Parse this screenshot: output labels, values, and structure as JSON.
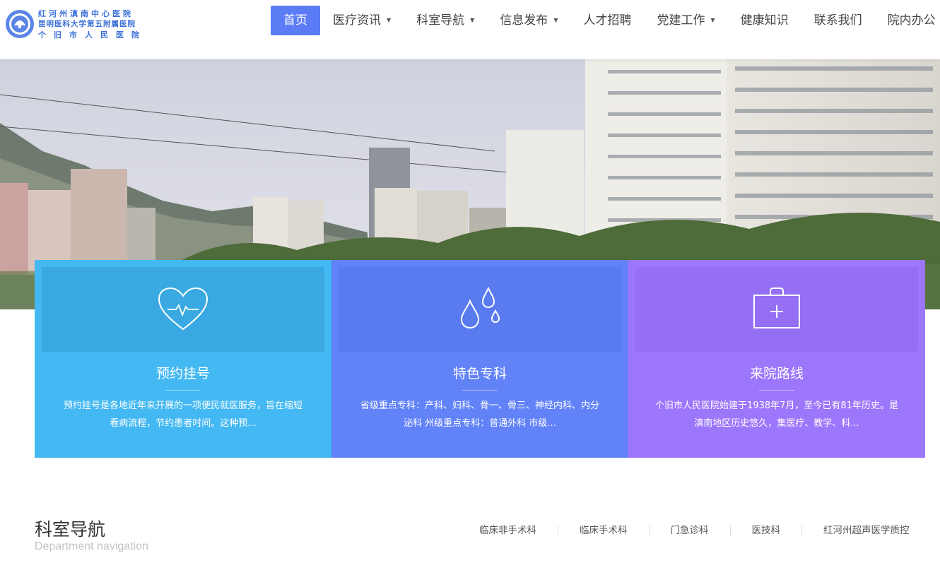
{
  "logo": {
    "line1": "红河州滇南中心医院",
    "line2": "昆明医科大学第五附属医院",
    "line3": "个旧市人民医院",
    "emblem_icon": "hospital-emblem-icon"
  },
  "nav": {
    "items": [
      {
        "label": "首页",
        "active": true
      },
      {
        "label": "医疗资讯",
        "caret": true
      },
      {
        "label": "科室导航",
        "caret": true
      },
      {
        "label": "信息发布",
        "caret": true
      },
      {
        "label": "人才招聘"
      },
      {
        "label": "党建工作",
        "caret": true
      },
      {
        "label": "健康知识"
      },
      {
        "label": "联系我们"
      },
      {
        "label": "院内办公"
      }
    ],
    "caret_glyph": "▼"
  },
  "cards": [
    {
      "title": "预约挂号",
      "desc": "预约挂号是各地近年来开展的一项便民就医服务，旨在缩短看病流程，节约患者时间。这种预...",
      "icon": "heartbeat-icon",
      "color": "#43b8f2",
      "inner_color": "#3aa9e1"
    },
    {
      "title": "特色专科",
      "desc": "省级重点专科：产科、妇科、骨一、骨三、神经内科、内分泌科 州级重点专科：普通外科 市级...",
      "icon": "water-drops-icon",
      "color": "#6282f8",
      "inner_color": "#5a7bf0"
    },
    {
      "title": "来院路线",
      "desc": "个旧市人民医院始建于1938年7月，至今已有81年历史。是滇南地区历史悠久，集医疗、教学、科...",
      "icon": "medical-kit-icon",
      "color": "#9c76fb",
      "inner_color": "#946ff4"
    }
  ],
  "section": {
    "title": "科室导航",
    "subtitle": "Department navigation",
    "tabs": [
      "临床非手术科",
      "临床手术科",
      "门急诊科",
      "医技科",
      "红河州超声医学质控"
    ]
  }
}
